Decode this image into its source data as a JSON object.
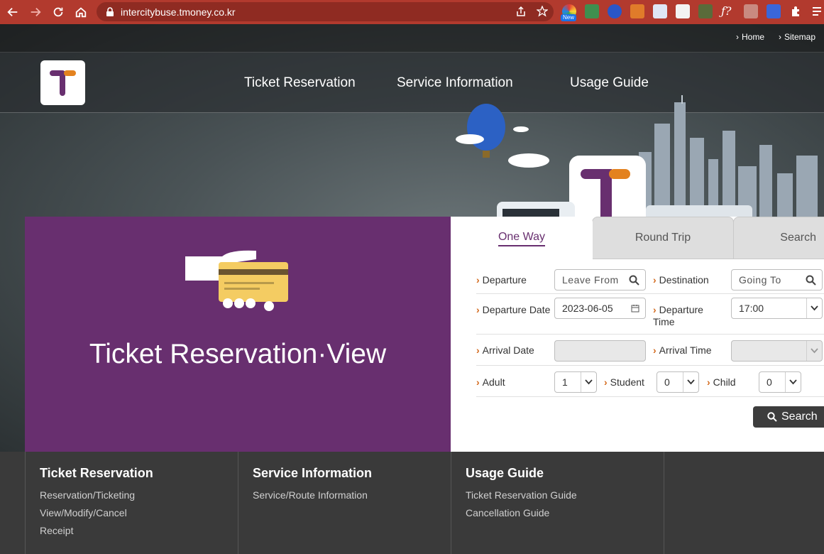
{
  "browser": {
    "url": "intercitybuse.tmoney.co.kr",
    "new_badge": "New"
  },
  "top_links": {
    "home": "Home",
    "sitemap": "Sitemap"
  },
  "nav": {
    "items": [
      "Ticket Reservation",
      "Service Information",
      "Usage Guide"
    ]
  },
  "hero": {
    "title": "Ticket Reservation·View"
  },
  "form": {
    "tabs": [
      "One Way",
      "Round Trip",
      "Search"
    ],
    "active_tab": "One Way",
    "departure_label": "Departure",
    "departure_placeholder": "Leave From",
    "destination_label": "Destination",
    "destination_placeholder": "Going To",
    "departure_date_label": "Departure Date",
    "departure_date_value": "2023-06-05",
    "departure_time_label": "Departure Time",
    "departure_time_value": "17:00",
    "arrival_date_label": "Arrival Date",
    "arrival_time_label": "Arrival Time",
    "adult_label": "Adult",
    "adult_value": "1",
    "student_label": "Student",
    "student_value": "0",
    "child_label": "Child",
    "child_value": "0",
    "search_button": "Search"
  },
  "footer": {
    "columns": [
      {
        "title": "Ticket Reservation",
        "links": [
          "Reservation/Ticketing",
          "View/Modify/Cancel",
          "Receipt"
        ]
      },
      {
        "title": "Service Information",
        "links": [
          "Service/Route Information"
        ]
      },
      {
        "title": "Usage Guide",
        "links": [
          "Ticket Reservation Guide",
          "Cancellation Guide"
        ]
      }
    ]
  },
  "colors": {
    "brand_purple": "#682f6f",
    "accent_orange": "#e3821f",
    "chrome_red": "#b23a2e"
  }
}
